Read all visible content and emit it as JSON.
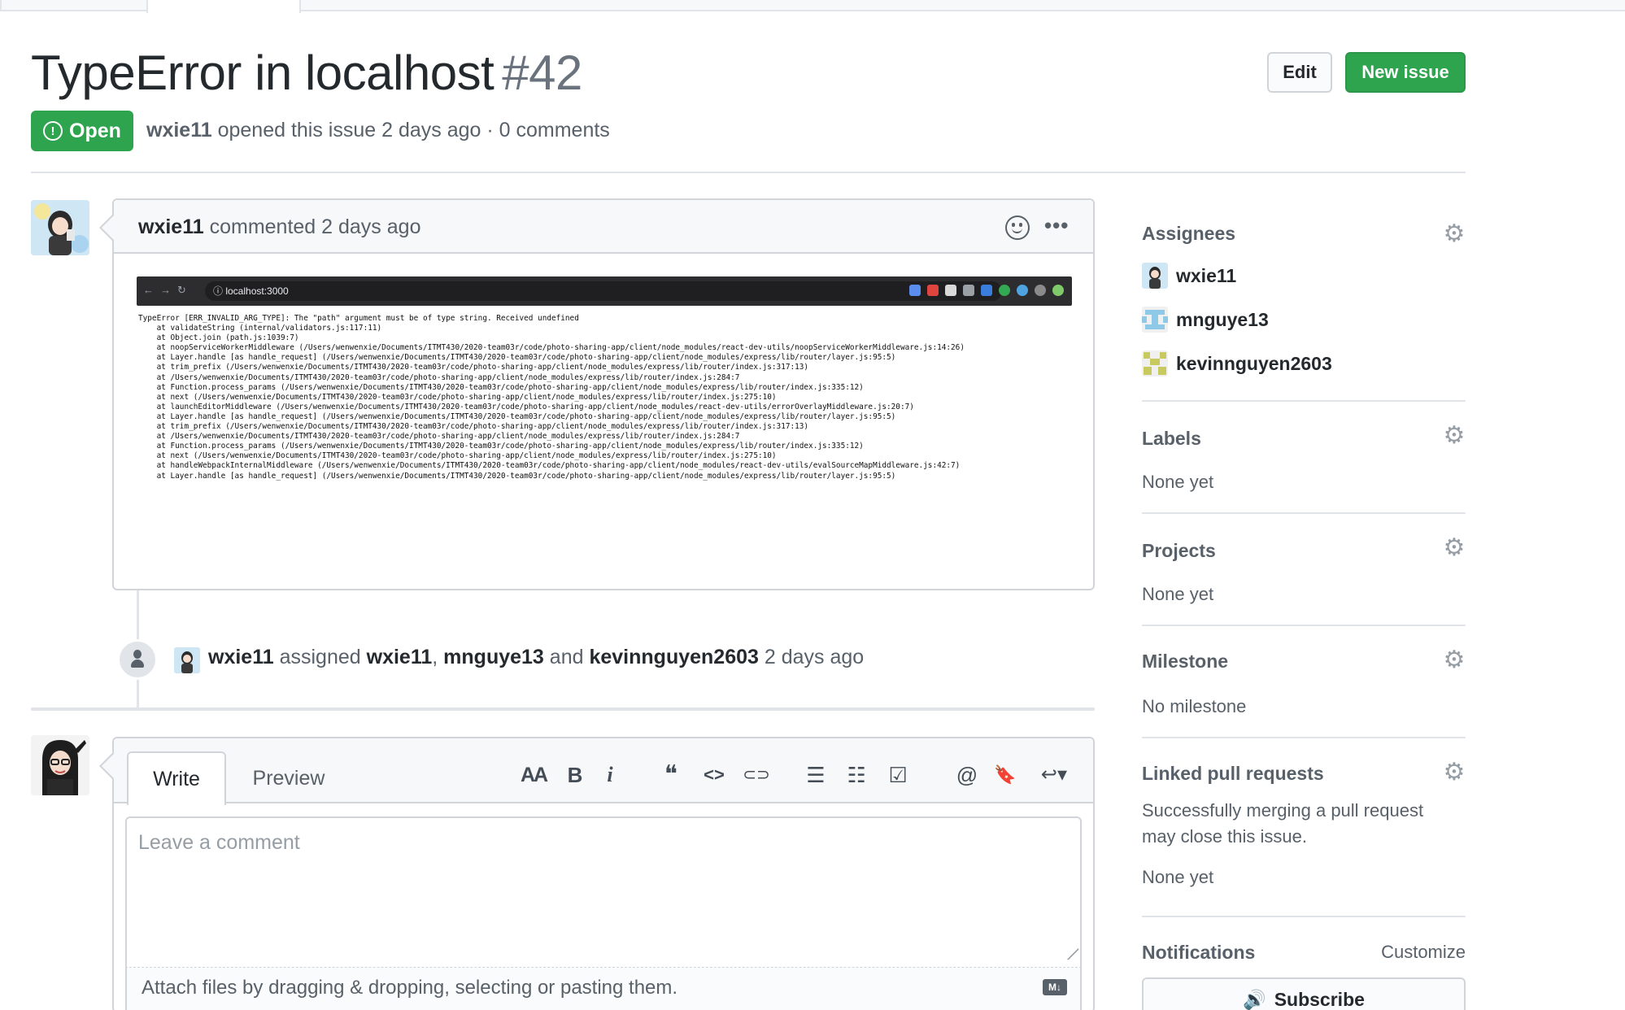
{
  "issue": {
    "title": "TypeError in localhost",
    "number": "#42",
    "state": "Open",
    "author": "wxie11",
    "meta_rest": "opened this issue 2 days ago · 0 comments"
  },
  "header_buttons": {
    "edit": "Edit",
    "new_issue": "New issue"
  },
  "comment": {
    "author": "wxie11",
    "action": "commented 2 days ago",
    "screenshot": {
      "url": "localhost:3000",
      "lines": [
        "TypeError [ERR_INVALID_ARG_TYPE]: The \"path\" argument must be of type string. Received undefined",
        "    at validateString (internal/validators.js:117:11)",
        "    at Object.join (path.js:1039:7)",
        "    at noopServiceWorkerMiddleware (/Users/wenwenxie/Documents/ITMT430/2020-team03r/code/photo-sharing-app/client/node_modules/react-dev-utils/noopServiceWorkerMiddleware.js:14:26)",
        "    at Layer.handle [as handle_request] (/Users/wenwenxie/Documents/ITMT430/2020-team03r/code/photo-sharing-app/client/node_modules/express/lib/router/layer.js:95:5)",
        "    at trim_prefix (/Users/wenwenxie/Documents/ITMT430/2020-team03r/code/photo-sharing-app/client/node_modules/express/lib/router/index.js:317:13)",
        "    at /Users/wenwenxie/Documents/ITMT430/2020-team03r/code/photo-sharing-app/client/node_modules/express/lib/router/index.js:284:7",
        "    at Function.process_params (/Users/wenwenxie/Documents/ITMT430/2020-team03r/code/photo-sharing-app/client/node_modules/express/lib/router/index.js:335:12)",
        "    at next (/Users/wenwenxie/Documents/ITMT430/2020-team03r/code/photo-sharing-app/client/node_modules/express/lib/router/index.js:275:10)",
        "    at launchEditorMiddleware (/Users/wenwenxie/Documents/ITMT430/2020-team03r/code/photo-sharing-app/client/node_modules/react-dev-utils/errorOverlayMiddleware.js:20:7)",
        "    at Layer.handle [as handle_request] (/Users/wenwenxie/Documents/ITMT430/2020-team03r/code/photo-sharing-app/client/node_modules/express/lib/router/layer.js:95:5)",
        "    at trim_prefix (/Users/wenwenxie/Documents/ITMT430/2020-team03r/code/photo-sharing-app/client/node_modules/express/lib/router/index.js:317:13)",
        "    at /Users/wenwenxie/Documents/ITMT430/2020-team03r/code/photo-sharing-app/client/node_modules/express/lib/router/index.js:284:7",
        "    at Function.process_params (/Users/wenwenxie/Documents/ITMT430/2020-team03r/code/photo-sharing-app/client/node_modules/express/lib/router/index.js:335:12)",
        "    at next (/Users/wenwenxie/Documents/ITMT430/2020-team03r/code/photo-sharing-app/client/node_modules/express/lib/router/index.js:275:10)",
        "    at handleWebpackInternalMiddleware (/Users/wenwenxie/Documents/ITMT430/2020-team03r/code/photo-sharing-app/client/node_modules/react-dev-utils/evalSourceMapMiddleware.js:42:7)",
        "    at Layer.handle [as handle_request] (/Users/wenwenxie/Documents/ITMT430/2020-team03r/code/photo-sharing-app/client/node_modules/express/lib/router/layer.js:95:5)"
      ]
    }
  },
  "event": {
    "actor": "wxie11",
    "verb": "assigned",
    "assignee_1": "wxie11",
    "sep_1": ",",
    "assignee_2": "mnguye13",
    "sep_2": "and",
    "assignee_3": "kevinnguyen2603",
    "time": "2 days ago"
  },
  "composer": {
    "tab_write": "Write",
    "tab_preview": "Preview",
    "placeholder": "Leave a comment",
    "attach_hint": "Attach files by dragging & dropping, selecting or pasting them.",
    "md_badge": "M↓",
    "toolbar": {
      "heading": "AA",
      "bold": "B",
      "italic": "i",
      "quote": "❝",
      "code": "<>",
      "link": "⊂⊃",
      "bullet_list": "☰",
      "numbered_list": "☷",
      "task_list": "☑",
      "mention": "@",
      "saved_reply": "🔖",
      "reply": "↩▾"
    }
  },
  "sidebar": {
    "assignees": {
      "title": "Assignees",
      "users": [
        "wxie11",
        "mnguye13",
        "kevinnguyen2603"
      ]
    },
    "labels": {
      "title": "Labels",
      "value": "None yet"
    },
    "projects": {
      "title": "Projects",
      "value": "None yet"
    },
    "milestone": {
      "title": "Milestone",
      "value": "No milestone"
    },
    "linked_prs": {
      "title": "Linked pull requests",
      "description_1": "Successfully merging a pull request",
      "description_2": "may close this issue.",
      "value": "None yet"
    },
    "notifications": {
      "title": "Notifications",
      "customize": "Customize",
      "subscribe": "Subscribe"
    }
  },
  "colors": {
    "open_green": "#2ea44f",
    "text_primary": "#24292e",
    "text_muted": "#586069",
    "border": "#d1d5da"
  }
}
